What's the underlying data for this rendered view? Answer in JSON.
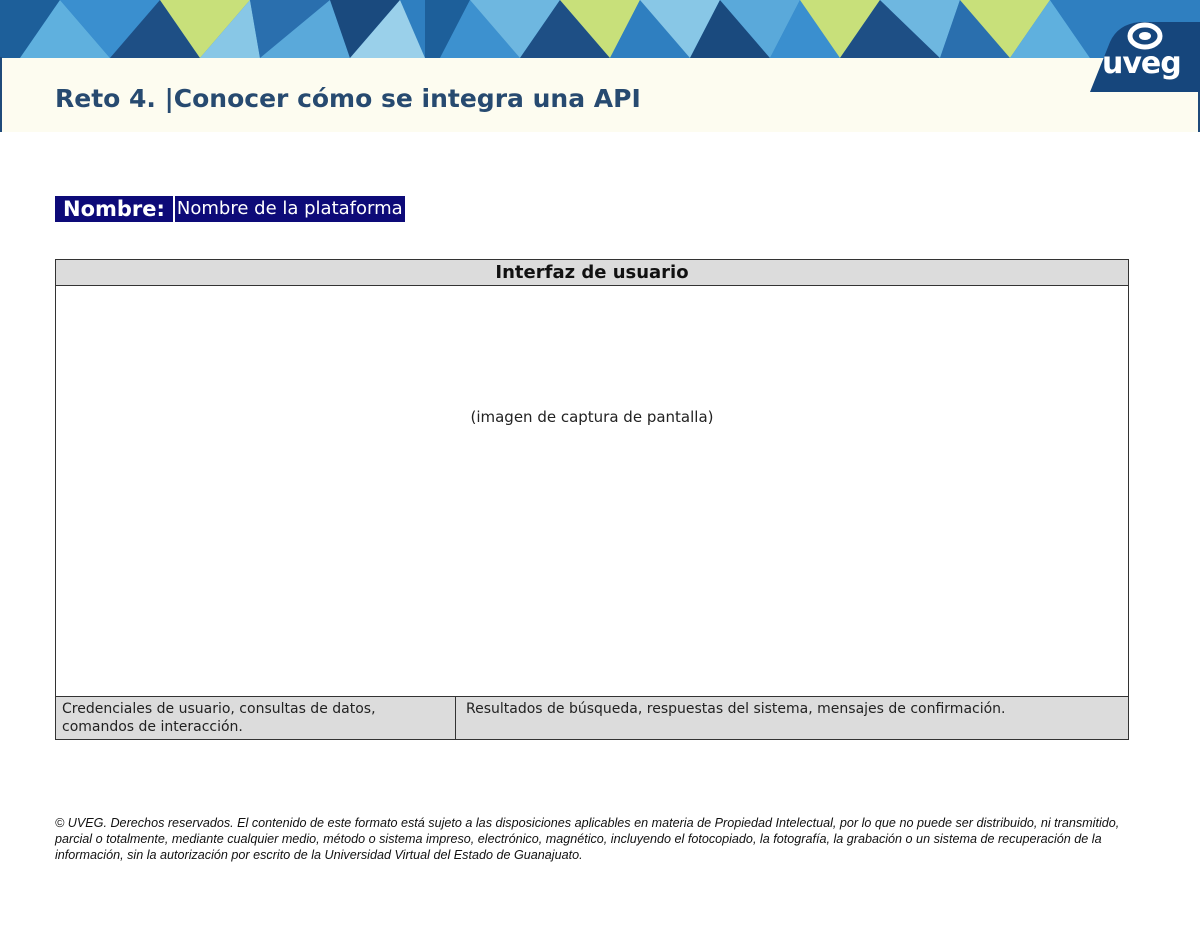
{
  "header": {
    "title": "Reto 4. |Conocer cómo se integra una API",
    "logo_text": "uveg",
    "logo_icon": "uveg-logo-icon",
    "colors": {
      "title": "#274a70",
      "banner_dark": "#1f4a7a",
      "accent_green": "#c8e07a"
    }
  },
  "name_field": {
    "label": "Nombre:",
    "value": "Nombre de la plataforma",
    "background": "#0d0a78"
  },
  "table": {
    "header": "Interfaz de usuario",
    "screenshot_placeholder": "(imagen de captura de pantalla)",
    "inputs": "Credenciales de usuario, consultas de datos, comandos de interacción.",
    "outputs": "Resultados de búsqueda, respuestas del sistema, mensajes de confirmación."
  },
  "footer": {
    "copyright": "© UVEG. Derechos reservados. El contenido de este formato está sujeto a las disposiciones aplicables en materia de Propiedad Intelectual, por lo que no puede ser distribuido, ni transmitido, parcial o totalmente, mediante cualquier medio, método o sistema impreso, electrónico, magnético, incluyendo el fotocopiado, la fotografía, la grabación o un sistema de recuperación de la información, sin la autorización por escrito de la Universidad Virtual del Estado de Guanajuato."
  }
}
